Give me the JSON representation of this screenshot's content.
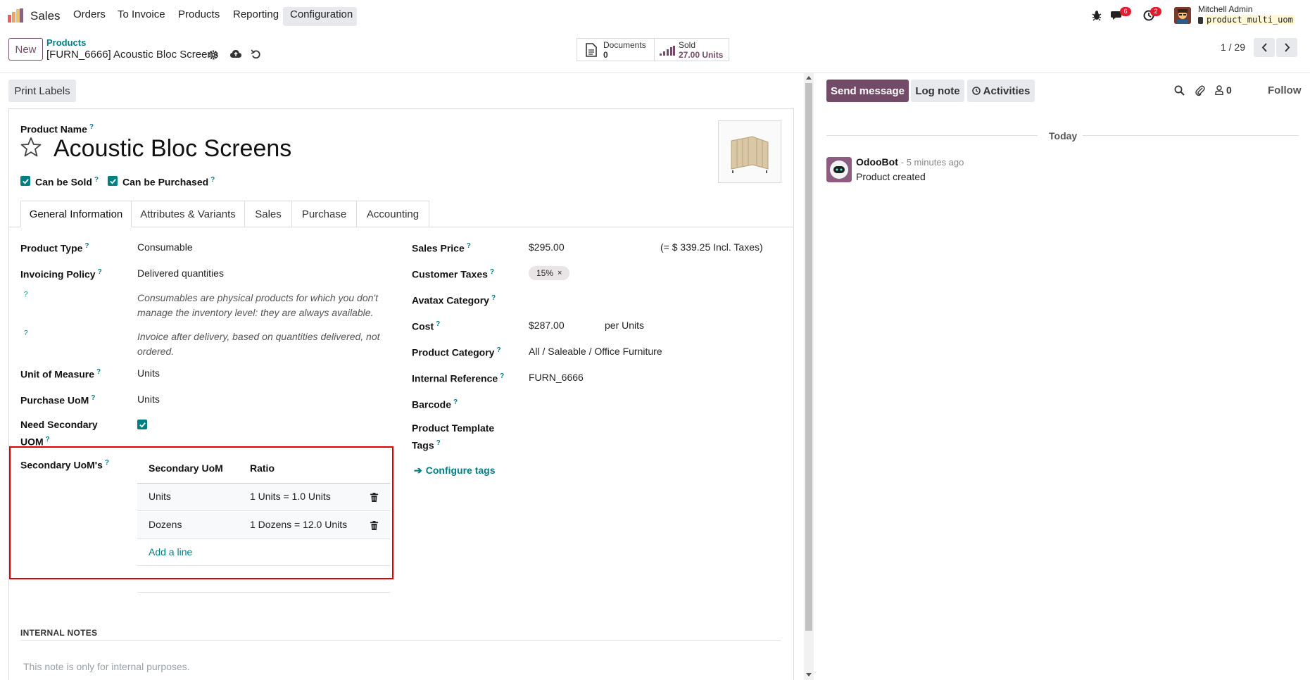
{
  "app": {
    "name": "Sales"
  },
  "nav": {
    "orders": "Orders",
    "to_invoice": "To Invoice",
    "products": "Products",
    "reporting": "Reporting",
    "configuration": "Configuration"
  },
  "systray": {
    "messages_count": "6",
    "activities_count": "2",
    "user_name": "Mitchell Admin",
    "database": "product_multi_uom"
  },
  "control": {
    "new_label": "New",
    "breadcrumb_parent": "Products",
    "breadcrumb_current": "[FURN_6666] Acoustic Bloc Screens",
    "documents_label": "Documents",
    "documents_count": "0",
    "sold_label": "Sold",
    "sold_value": "27.00 Units",
    "pager": "1 / 29"
  },
  "statusbar": {
    "print_labels": "Print Labels"
  },
  "product": {
    "name_label": "Product Name",
    "name": "Acoustic Bloc Screens",
    "can_be_sold": "Can be Sold",
    "can_be_purchased": "Can be Purchased"
  },
  "tabs": [
    "General Information",
    "Attributes & Variants",
    "Sales",
    "Purchase",
    "Accounting"
  ],
  "left_fields": {
    "product_type_label": "Product Type",
    "product_type": "Consumable",
    "invoicing_policy_label": "Invoicing Policy",
    "invoicing_policy": "Delivered quantities",
    "help1_line1": "Consumables are physical products for which you don't",
    "help1_line2": "manage the inventory level: they are always available.",
    "help2_line1": "Invoice after delivery, based on quantities delivered, not",
    "help2_line2": "ordered.",
    "uom_label": "Unit of Measure",
    "uom": "Units",
    "purchase_uom_label": "Purchase UoM",
    "purchase_uom": "Units",
    "need_secondary_line1": "Need Secondary",
    "need_secondary_line2": "UOM",
    "secondary_uoms_label": "Secondary UoM's"
  },
  "secondary_table": {
    "col_uom": "Secondary UoM",
    "col_ratio": "Ratio",
    "rows": [
      {
        "uom": "Units",
        "ratio": "1 Units = 1.0 Units"
      },
      {
        "uom": "Dozens",
        "ratio": "1 Dozens = 12.0 Units"
      }
    ],
    "add_line": "Add a line"
  },
  "right_fields": {
    "sales_price_label": "Sales Price",
    "sales_price": "$295.00",
    "incl_taxes": "(= $ 339.25 Incl. Taxes)",
    "customer_taxes_label": "Customer Taxes",
    "tax_tag": "15%",
    "avatax_label": "Avatax Category",
    "cost_label": "Cost",
    "cost": "$287.00",
    "cost_unit": "per Units",
    "category_label": "Product Category",
    "category": "All / Saleable / Office Furniture",
    "internal_ref_label": "Internal Reference",
    "internal_ref": "FURN_6666",
    "barcode_label": "Barcode",
    "template_tags_line1": "Product Template",
    "template_tags_line2": "Tags",
    "configure_tags": "Configure tags"
  },
  "notes": {
    "heading": "INTERNAL NOTES",
    "placeholder": "This note is only for internal purposes."
  },
  "chatter": {
    "send_message": "Send message",
    "log_note": "Log note",
    "activities": "Activities",
    "followers_count": "0",
    "follow": "Follow",
    "today": "Today",
    "author": "OdooBot",
    "time": "- 5 minutes ago",
    "body": "Product created"
  },
  "colors": {
    "brand": "#714b67",
    "accent": "#017e84",
    "highlight": "#e00000"
  }
}
